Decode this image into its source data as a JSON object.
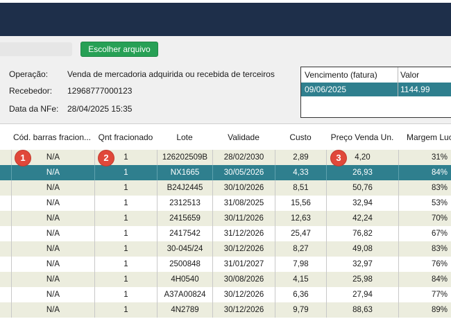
{
  "file": {
    "choose_label": "Escolher arquivo"
  },
  "info": {
    "operacao_label": "Operação:",
    "operacao_value": "Venda de mercadoria adquirida ou recebida de terceiros",
    "recebedor_label": "Recebedor:",
    "recebedor_value": "12968777000123",
    "data_label": "Data da NFe:",
    "data_value": "28/04/2025 15:35"
  },
  "vencimento": {
    "col1": "Vencimento (fatura)",
    "col2": "Valor",
    "rows": [
      {
        "date": "09/06/2025",
        "value": "1144.99"
      }
    ]
  },
  "table": {
    "headers": [
      "Cód. barras fracion...",
      "Qnt fracionado",
      "Lote",
      "Validade",
      "Custo",
      "Preço Venda Un.",
      "Margem Lucro"
    ],
    "rows": [
      [
        "N/A",
        "1",
        "126202509B",
        "28/02/2030",
        "2,89",
        "4,20",
        "31%"
      ],
      [
        "N/A",
        "1",
        "NX1665",
        "30/05/2026",
        "4,33",
        "26,93",
        "84%"
      ],
      [
        "N/A",
        "1",
        "B24J2445",
        "30/10/2026",
        "8,51",
        "50,76",
        "83%"
      ],
      [
        "N/A",
        "1",
        "2312513",
        "31/08/2025",
        "15,56",
        "32,94",
        "53%"
      ],
      [
        "N/A",
        "1",
        "2415659",
        "30/11/2026",
        "12,63",
        "42,24",
        "70%"
      ],
      [
        "N/A",
        "1",
        "2417542",
        "31/12/2026",
        "25,47",
        "76,82",
        "67%"
      ],
      [
        "N/A",
        "1",
        "30-045/24",
        "30/12/2026",
        "8,27",
        "49,08",
        "83%"
      ],
      [
        "N/A",
        "1",
        "2500848",
        "31/01/2027",
        "7,98",
        "32,97",
        "76%"
      ],
      [
        "N/A",
        "1",
        "4H0540",
        "30/08/2026",
        "4,15",
        "25,98",
        "84%"
      ],
      [
        "N/A",
        "1",
        "A37A00824",
        "30/12/2026",
        "6,36",
        "27,94",
        "77%"
      ],
      [
        "N/A",
        "1",
        "4N2789",
        "30/12/2026",
        "9,79",
        "88,63",
        "89%"
      ]
    ],
    "selected_row": 1
  },
  "badges": [
    "1",
    "2",
    "3"
  ],
  "colors": {
    "accent": "#2f7f8e",
    "topbar": "#1e2f4a",
    "button": "#27a055",
    "badge": "#e0483a",
    "row_alt": "#ecedde"
  }
}
